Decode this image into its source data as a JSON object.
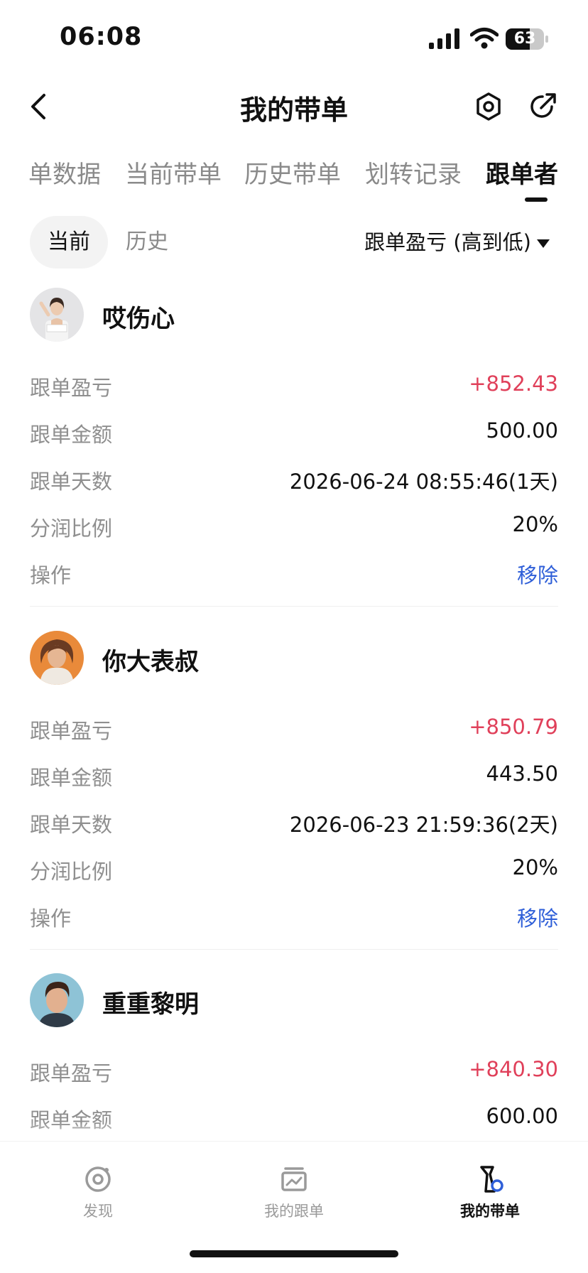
{
  "status_bar": {
    "time": "06:08",
    "battery": "63",
    "battery_level": 0.63
  },
  "header": {
    "title": "我的带单"
  },
  "tabs": [
    {
      "label": "单数据",
      "active": false
    },
    {
      "label": "当前带单",
      "active": false
    },
    {
      "label": "历史带单",
      "active": false
    },
    {
      "label": "划转记录",
      "active": false
    },
    {
      "label": "跟单者",
      "active": true
    }
  ],
  "segment": {
    "current": "当前",
    "history": "历史",
    "selected": "当前"
  },
  "sort": {
    "label": "跟单盈亏 (高到低)"
  },
  "followers": [
    {
      "name": "哎伤心",
      "rows": [
        {
          "label": "跟单盈亏",
          "value": "+852.43"
        },
        {
          "label": "跟单金额",
          "value": "500.00"
        },
        {
          "label": "跟单天数",
          "value": "2026-06-24 08:55:46(1天)"
        },
        {
          "label": "分润比例",
          "value": "20%"
        },
        {
          "label": "操作",
          "value": "移除"
        }
      ]
    },
    {
      "name": "你大表叔",
      "rows": [
        {
          "label": "跟单盈亏",
          "value": "+850.79"
        },
        {
          "label": "跟单金额",
          "value": "443.50"
        },
        {
          "label": "跟单天数",
          "value": "2026-06-23 21:59:36(2天)"
        },
        {
          "label": "分润比例",
          "value": "20%"
        },
        {
          "label": "操作",
          "value": "移除"
        }
      ]
    },
    {
      "name": "重重黎明",
      "rows": [
        {
          "label": "跟单盈亏",
          "value": "+840.30"
        },
        {
          "label": "跟单金额",
          "value": "600.00"
        }
      ]
    }
  ],
  "bottom_nav": [
    {
      "label": "发现",
      "icon": "discover-icon",
      "active": false
    },
    {
      "label": "我的跟单",
      "icon": "copy-trade-icon",
      "active": false
    },
    {
      "label": "我的带单",
      "icon": "lead-trade-icon",
      "active": true
    }
  ],
  "colors": {
    "profit": "#e0405a",
    "action": "#2f5fd8",
    "text": "#111111",
    "muted": "#8f8f8f"
  }
}
